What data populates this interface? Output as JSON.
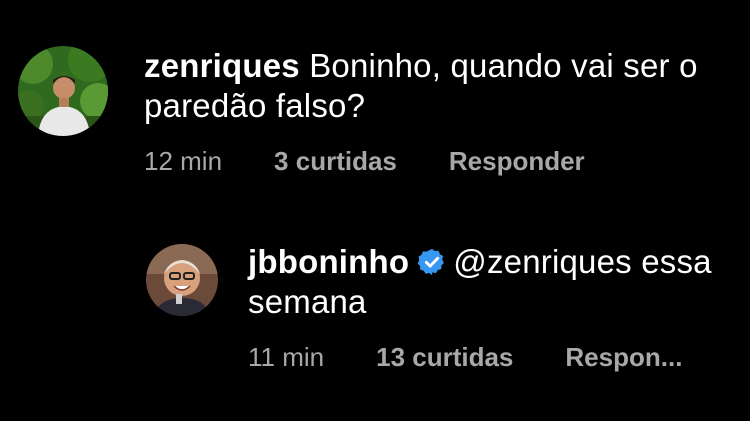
{
  "comments": [
    {
      "username": "zenriques",
      "text": "Boninho, quando vai ser o paredão falso?",
      "time": "12 min",
      "likes": "3 curtidas",
      "reply_label": "Responder",
      "avatar_icon": "profile-photo-young-man-outdoors"
    }
  ],
  "reply": {
    "username": "jbboninho",
    "verified": true,
    "mention": "@zenriques",
    "text": " essa semana",
    "time": "11 min",
    "likes": "13 curtidas",
    "reply_label": "Respon...",
    "avatar_icon": "profile-photo-smiling-man-glasses"
  },
  "colors": {
    "background": "#000000",
    "text": "#ffffff",
    "meta": "#a8a8a8",
    "verified_badge": "#3897f0"
  }
}
